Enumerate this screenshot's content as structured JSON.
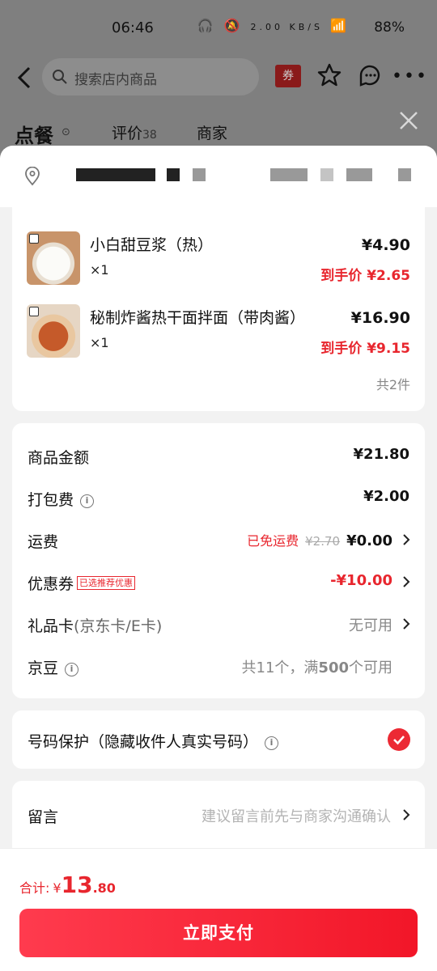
{
  "status_bar": {
    "time": "06:46",
    "speed": "2.00 KB/S",
    "battery": "88%"
  },
  "header": {
    "search_placeholder": "搜索店内商品",
    "coupon_label": "券"
  },
  "tabs": {
    "order": "点餐",
    "review": "评价",
    "review_count": "38",
    "shop": "商家"
  },
  "goods": {
    "items": [
      {
        "name": "小白甜豆浆（热）",
        "qty": "×1",
        "price": "¥4.90",
        "final_price": "到手价 ¥2.65"
      },
      {
        "name": "秘制炸酱热干面拌面（带肉酱）",
        "qty": "×1",
        "price": "¥16.90",
        "final_price": "到手价 ¥9.15"
      }
    ],
    "total_count": "共2件"
  },
  "fees": {
    "goods_amount": {
      "label": "商品金额",
      "value": "¥21.80"
    },
    "packing": {
      "label": "打包费",
      "value": "¥2.00"
    },
    "delivery": {
      "label": "运费",
      "free_text": "已免运费",
      "original": "¥2.70",
      "value": "¥0.00"
    },
    "coupon": {
      "label": "优惠券",
      "tag": "已选推荐优惠",
      "value": "-¥10.00"
    },
    "gift_card": {
      "label": "礼品卡",
      "sub": "(京东卡/E卡)",
      "value": "无可用"
    },
    "jingdou": {
      "label": "京豆",
      "value_prefix": "共11个，满",
      "value_bold": "500",
      "value_suffix": "个可用"
    }
  },
  "protect": {
    "label": "号码保护（隐藏收件人真实号码）"
  },
  "note": {
    "label": "留言",
    "placeholder": "建议留言前先与商家沟通确认"
  },
  "footer": {
    "total_label": "合计:",
    "currency": "¥",
    "amount_int": "13",
    "amount_dec": ".80",
    "pay_button": "立即支付"
  },
  "colors": {
    "accent_red": "#e8262e",
    "pay_button": "#f21628"
  }
}
